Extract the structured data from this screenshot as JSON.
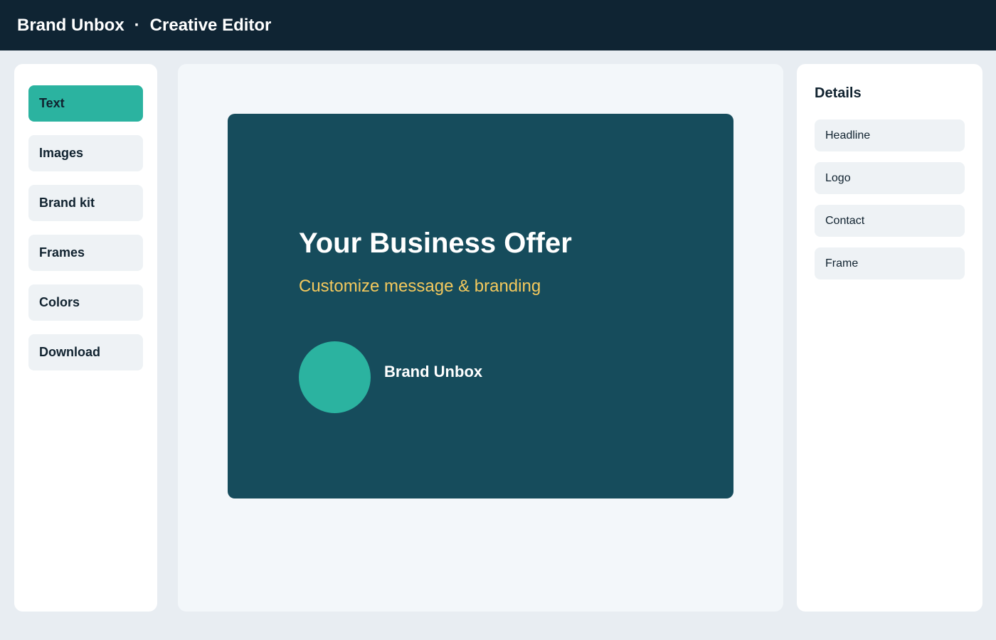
{
  "header": {
    "brand": "Brand Unbox",
    "separator": "·",
    "title": "Creative Editor"
  },
  "tools": [
    {
      "label": "Text",
      "active": true
    },
    {
      "label": "Images",
      "active": false
    },
    {
      "label": "Brand kit",
      "active": false
    },
    {
      "label": "Frames",
      "active": false
    },
    {
      "label": "Colors",
      "active": false
    },
    {
      "label": "Download",
      "active": false
    }
  ],
  "canvas": {
    "headline": "Your Business Offer",
    "subline": "Customize message & branding",
    "brand_name": "Brand Unbox",
    "card_color": "#164c5c",
    "accent_color": "#2bb3a0",
    "subline_color": "#f4c95d"
  },
  "details": {
    "title": "Details",
    "items": [
      "Headline",
      "Logo",
      "Contact",
      "Frame"
    ]
  }
}
